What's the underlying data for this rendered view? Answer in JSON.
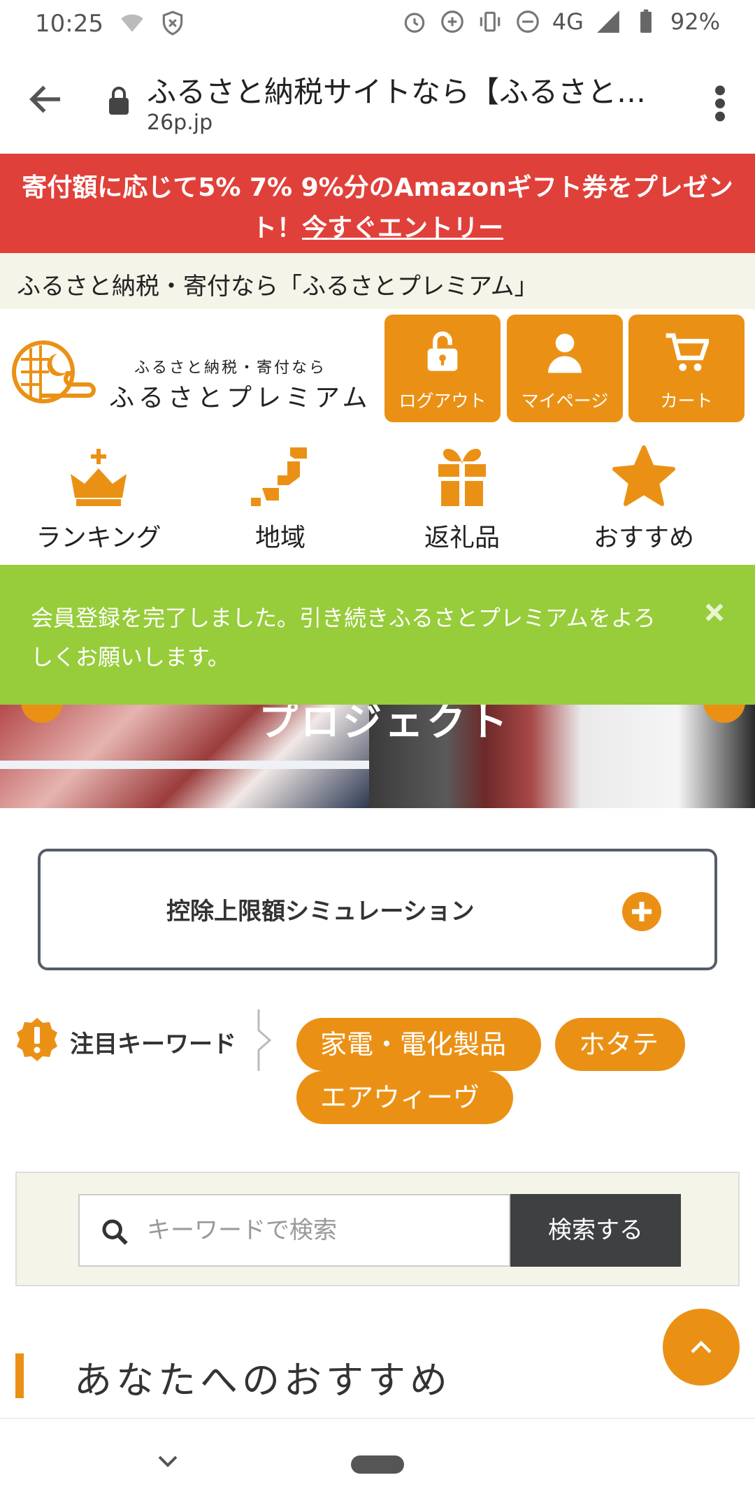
{
  "status": {
    "time": "10:25",
    "network": "4G",
    "battery": "92%"
  },
  "browser": {
    "title": "ふるさと納税サイトなら【ふるさと…",
    "domain": "26p.jp"
  },
  "promo": {
    "text": "寄付額に応じて5% 7% 9%分のAmazonギフト券をプレゼント！",
    "link": "今すぐエントリー"
  },
  "tagline": "ふるさと納税・寄付なら「ふるさとプレミアム」",
  "logo": {
    "sub": "ふるさと納税・寄付なら",
    "main": "ふるさとプレミアム"
  },
  "header_buttons": [
    {
      "label": "ログアウト",
      "icon": "unlock-icon"
    },
    {
      "label": "マイページ",
      "icon": "user-icon"
    },
    {
      "label": "カート",
      "icon": "cart-icon"
    }
  ],
  "nav": [
    {
      "label": "ランキング",
      "icon": "crown-icon"
    },
    {
      "label": "地域",
      "icon": "map-icon"
    },
    {
      "label": "返礼品",
      "icon": "gift-icon"
    },
    {
      "label": "おすすめ",
      "icon": "star-icon"
    }
  ],
  "notice": {
    "text": "会員登録を完了しました。引き続きふるさとプレミアムをよろしくお願いします。"
  },
  "hero": {
    "text": "プロジェクト"
  },
  "simulation": {
    "label": "控除上限額シミュレーション"
  },
  "keywords": {
    "title": "注目キーワード",
    "tags": [
      "家電・電化製品",
      "ホタテ",
      "エアウィーヴ"
    ]
  },
  "search": {
    "placeholder": "キーワードで検索",
    "button": "検索する"
  },
  "recommend": {
    "title": "あなたへのおすすめ"
  },
  "colors": {
    "accent": "#ea9115",
    "promo": "#e0403a",
    "notice": "#97cc3a",
    "dark": "#3f4042"
  }
}
